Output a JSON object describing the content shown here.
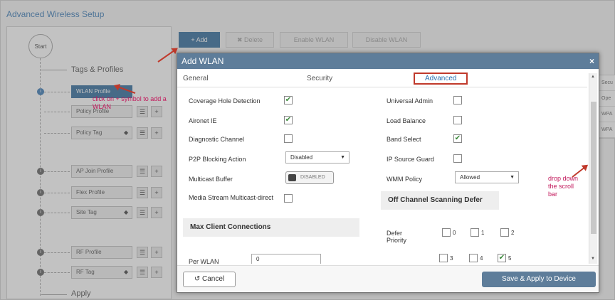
{
  "page": {
    "title": "Advanced Wireless Setup"
  },
  "toolbar": {
    "add": "+ Add",
    "delete": "✖ Delete",
    "enable": "Enable WLAN",
    "disable": "Disable WLAN"
  },
  "tree": {
    "start": "Start",
    "group_tags": "Tags & Profiles",
    "group_apply": "Apply",
    "items": [
      {
        "label": "WLAN Profile"
      },
      {
        "label": "Policy Profile"
      },
      {
        "label": "Policy Tag"
      },
      {
        "label": "AP Join Profile"
      },
      {
        "label": "Flex Profile"
      },
      {
        "label": "Site Tag"
      },
      {
        "label": "RF Profile"
      },
      {
        "label": "RF Tag"
      }
    ]
  },
  "right_table": [
    "Secu",
    "Ope",
    "WPA",
    "WPA"
  ],
  "modal": {
    "title": "Add WLAN",
    "close": "×",
    "tabs": [
      "General",
      "Security",
      "Advanced"
    ],
    "left": {
      "coverage_hole": "Coverage Hole Detection",
      "aironet_ie": "Aironet IE",
      "diagnostic": "Diagnostic Channel",
      "p2p": "P2P Blocking Action",
      "p2p_value": "Disabled",
      "multicast_buffer": "Multicast Buffer",
      "multicast_value": "DISABLED",
      "media_stream": "Media Stream Multicast-direct",
      "max_clients": "Max Client Connections",
      "per_wlan": "Per WLAN",
      "per_wlan_value": "0"
    },
    "right": {
      "universal_admin": "Universal Admin",
      "load_balance": "Load Balance",
      "band_select": "Band Select",
      "ip_source_guard": "IP Source Guard",
      "wmm_policy": "WMM Policy",
      "wmm_value": "Allowed",
      "off_channel": "Off Channel Scanning Defer",
      "defer_priority": "Defer Priority",
      "priorities": [
        "0",
        "1",
        "2",
        "3",
        "4",
        "5"
      ]
    },
    "check_mark": "✔",
    "cancel": "↺ Cancel",
    "save": "Save & Apply to Device"
  },
  "annotations": {
    "left_note": "click on + symbol to add a WLAN",
    "right_note": "drop down the scroll bar"
  },
  "colors": {
    "accent": "#1f5f94",
    "modal_header": "#5e7d9a",
    "annotation": "#c0392b"
  }
}
